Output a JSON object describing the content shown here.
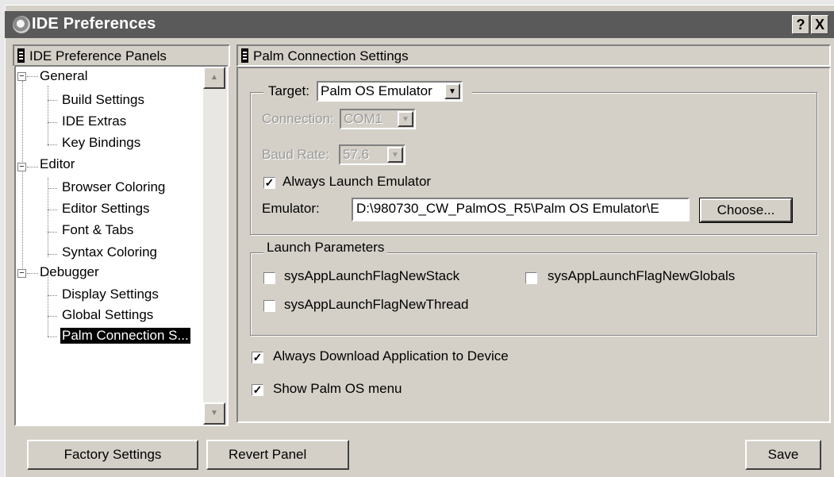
{
  "window": {
    "title": "IDE Preferences",
    "help_label": "?",
    "close_label": "X"
  },
  "left_panel": {
    "header": "IDE Preference Panels",
    "tree": [
      {
        "label": "General",
        "expander": "−"
      },
      {
        "label": "Build Settings"
      },
      {
        "label": "IDE Extras"
      },
      {
        "label": "Key Bindings"
      },
      {
        "label": "Editor",
        "expander": "−"
      },
      {
        "label": "Browser Coloring"
      },
      {
        "label": "Editor Settings"
      },
      {
        "label": "Font & Tabs"
      },
      {
        "label": "Syntax Coloring"
      },
      {
        "label": "Debugger",
        "expander": "−"
      },
      {
        "label": "Display Settings"
      },
      {
        "label": "Global Settings"
      },
      {
        "label": "Palm Connection S..."
      }
    ]
  },
  "right_panel": {
    "header": "Palm Connection Settings",
    "target": {
      "label": "Target:",
      "value": "Palm OS Emulator"
    },
    "connection": {
      "label": "Connection:",
      "value": "COM1"
    },
    "baud_rate": {
      "label": "Baud Rate:",
      "value": "57.6"
    },
    "always_launch_emulator": {
      "label": "Always Launch Emulator",
      "checked": true
    },
    "emulator": {
      "label": "Emulator:",
      "value": "D:\\980730_CW_PalmOS_R5\\Palm OS Emulator\\E",
      "choose_label": "Choose..."
    },
    "launch_parameters": {
      "legend": "Launch Parameters",
      "new_stack": {
        "label": "sysAppLaunchFlagNewStack",
        "checked": false
      },
      "new_globals": {
        "label": "sysAppLaunchFlagNewGlobals",
        "checked": false
      },
      "new_thread": {
        "label": "sysAppLaunchFlagNewThread",
        "checked": false
      }
    },
    "always_download": {
      "label": "Always Download Application to Device",
      "checked": true
    },
    "show_palm_menu": {
      "label": "Show Palm OS menu",
      "checked": true
    }
  },
  "footer": {
    "factory_settings": "Factory Settings",
    "revert_panel": "Revert Panel",
    "save": "Save"
  },
  "glyphs": {
    "check": "✓",
    "arrow_down": "▼",
    "arrow_up": "▲"
  },
  "colors": {
    "title_bar": "#5a5a5a",
    "face": "#d4d0c8",
    "selection": "#000000"
  }
}
